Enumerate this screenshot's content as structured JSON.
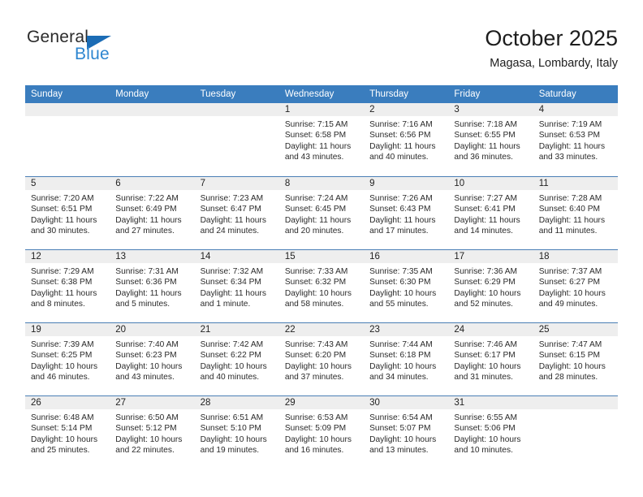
{
  "brand": {
    "name_part1": "General",
    "name_part2": "Blue",
    "triangle_color": "#1b6cb5",
    "text_color": "#2e86d0"
  },
  "header": {
    "title": "October 2025",
    "subtitle": "Magasa, Lombardy, Italy"
  },
  "theme": {
    "header_row_bg": "#3a7dbe",
    "header_row_text": "#ffffff",
    "day_band_bg": "#eeeeee",
    "week_separator": "#4a7fb5"
  },
  "weekdays": [
    "Sunday",
    "Monday",
    "Tuesday",
    "Wednesday",
    "Thursday",
    "Friday",
    "Saturday"
  ],
  "weeks": [
    [
      {
        "num": "",
        "lines": []
      },
      {
        "num": "",
        "lines": []
      },
      {
        "num": "",
        "lines": []
      },
      {
        "num": "1",
        "lines": [
          "Sunrise: 7:15 AM",
          "Sunset: 6:58 PM",
          "Daylight: 11 hours",
          "and 43 minutes."
        ]
      },
      {
        "num": "2",
        "lines": [
          "Sunrise: 7:16 AM",
          "Sunset: 6:56 PM",
          "Daylight: 11 hours",
          "and 40 minutes."
        ]
      },
      {
        "num": "3",
        "lines": [
          "Sunrise: 7:18 AM",
          "Sunset: 6:55 PM",
          "Daylight: 11 hours",
          "and 36 minutes."
        ]
      },
      {
        "num": "4",
        "lines": [
          "Sunrise: 7:19 AM",
          "Sunset: 6:53 PM",
          "Daylight: 11 hours",
          "and 33 minutes."
        ]
      }
    ],
    [
      {
        "num": "5",
        "lines": [
          "Sunrise: 7:20 AM",
          "Sunset: 6:51 PM",
          "Daylight: 11 hours",
          "and 30 minutes."
        ]
      },
      {
        "num": "6",
        "lines": [
          "Sunrise: 7:22 AM",
          "Sunset: 6:49 PM",
          "Daylight: 11 hours",
          "and 27 minutes."
        ]
      },
      {
        "num": "7",
        "lines": [
          "Sunrise: 7:23 AM",
          "Sunset: 6:47 PM",
          "Daylight: 11 hours",
          "and 24 minutes."
        ]
      },
      {
        "num": "8",
        "lines": [
          "Sunrise: 7:24 AM",
          "Sunset: 6:45 PM",
          "Daylight: 11 hours",
          "and 20 minutes."
        ]
      },
      {
        "num": "9",
        "lines": [
          "Sunrise: 7:26 AM",
          "Sunset: 6:43 PM",
          "Daylight: 11 hours",
          "and 17 minutes."
        ]
      },
      {
        "num": "10",
        "lines": [
          "Sunrise: 7:27 AM",
          "Sunset: 6:41 PM",
          "Daylight: 11 hours",
          "and 14 minutes."
        ]
      },
      {
        "num": "11",
        "lines": [
          "Sunrise: 7:28 AM",
          "Sunset: 6:40 PM",
          "Daylight: 11 hours",
          "and 11 minutes."
        ]
      }
    ],
    [
      {
        "num": "12",
        "lines": [
          "Sunrise: 7:29 AM",
          "Sunset: 6:38 PM",
          "Daylight: 11 hours",
          "and 8 minutes."
        ]
      },
      {
        "num": "13",
        "lines": [
          "Sunrise: 7:31 AM",
          "Sunset: 6:36 PM",
          "Daylight: 11 hours",
          "and 5 minutes."
        ]
      },
      {
        "num": "14",
        "lines": [
          "Sunrise: 7:32 AM",
          "Sunset: 6:34 PM",
          "Daylight: 11 hours",
          "and 1 minute."
        ]
      },
      {
        "num": "15",
        "lines": [
          "Sunrise: 7:33 AM",
          "Sunset: 6:32 PM",
          "Daylight: 10 hours",
          "and 58 minutes."
        ]
      },
      {
        "num": "16",
        "lines": [
          "Sunrise: 7:35 AM",
          "Sunset: 6:30 PM",
          "Daylight: 10 hours",
          "and 55 minutes."
        ]
      },
      {
        "num": "17",
        "lines": [
          "Sunrise: 7:36 AM",
          "Sunset: 6:29 PM",
          "Daylight: 10 hours",
          "and 52 minutes."
        ]
      },
      {
        "num": "18",
        "lines": [
          "Sunrise: 7:37 AM",
          "Sunset: 6:27 PM",
          "Daylight: 10 hours",
          "and 49 minutes."
        ]
      }
    ],
    [
      {
        "num": "19",
        "lines": [
          "Sunrise: 7:39 AM",
          "Sunset: 6:25 PM",
          "Daylight: 10 hours",
          "and 46 minutes."
        ]
      },
      {
        "num": "20",
        "lines": [
          "Sunrise: 7:40 AM",
          "Sunset: 6:23 PM",
          "Daylight: 10 hours",
          "and 43 minutes."
        ]
      },
      {
        "num": "21",
        "lines": [
          "Sunrise: 7:42 AM",
          "Sunset: 6:22 PM",
          "Daylight: 10 hours",
          "and 40 minutes."
        ]
      },
      {
        "num": "22",
        "lines": [
          "Sunrise: 7:43 AM",
          "Sunset: 6:20 PM",
          "Daylight: 10 hours",
          "and 37 minutes."
        ]
      },
      {
        "num": "23",
        "lines": [
          "Sunrise: 7:44 AM",
          "Sunset: 6:18 PM",
          "Daylight: 10 hours",
          "and 34 minutes."
        ]
      },
      {
        "num": "24",
        "lines": [
          "Sunrise: 7:46 AM",
          "Sunset: 6:17 PM",
          "Daylight: 10 hours",
          "and 31 minutes."
        ]
      },
      {
        "num": "25",
        "lines": [
          "Sunrise: 7:47 AM",
          "Sunset: 6:15 PM",
          "Daylight: 10 hours",
          "and 28 minutes."
        ]
      }
    ],
    [
      {
        "num": "26",
        "lines": [
          "Sunrise: 6:48 AM",
          "Sunset: 5:14 PM",
          "Daylight: 10 hours",
          "and 25 minutes."
        ]
      },
      {
        "num": "27",
        "lines": [
          "Sunrise: 6:50 AM",
          "Sunset: 5:12 PM",
          "Daylight: 10 hours",
          "and 22 minutes."
        ]
      },
      {
        "num": "28",
        "lines": [
          "Sunrise: 6:51 AM",
          "Sunset: 5:10 PM",
          "Daylight: 10 hours",
          "and 19 minutes."
        ]
      },
      {
        "num": "29",
        "lines": [
          "Sunrise: 6:53 AM",
          "Sunset: 5:09 PM",
          "Daylight: 10 hours",
          "and 16 minutes."
        ]
      },
      {
        "num": "30",
        "lines": [
          "Sunrise: 6:54 AM",
          "Sunset: 5:07 PM",
          "Daylight: 10 hours",
          "and 13 minutes."
        ]
      },
      {
        "num": "31",
        "lines": [
          "Sunrise: 6:55 AM",
          "Sunset: 5:06 PM",
          "Daylight: 10 hours",
          "and 10 minutes."
        ]
      },
      {
        "num": "",
        "lines": []
      }
    ]
  ]
}
